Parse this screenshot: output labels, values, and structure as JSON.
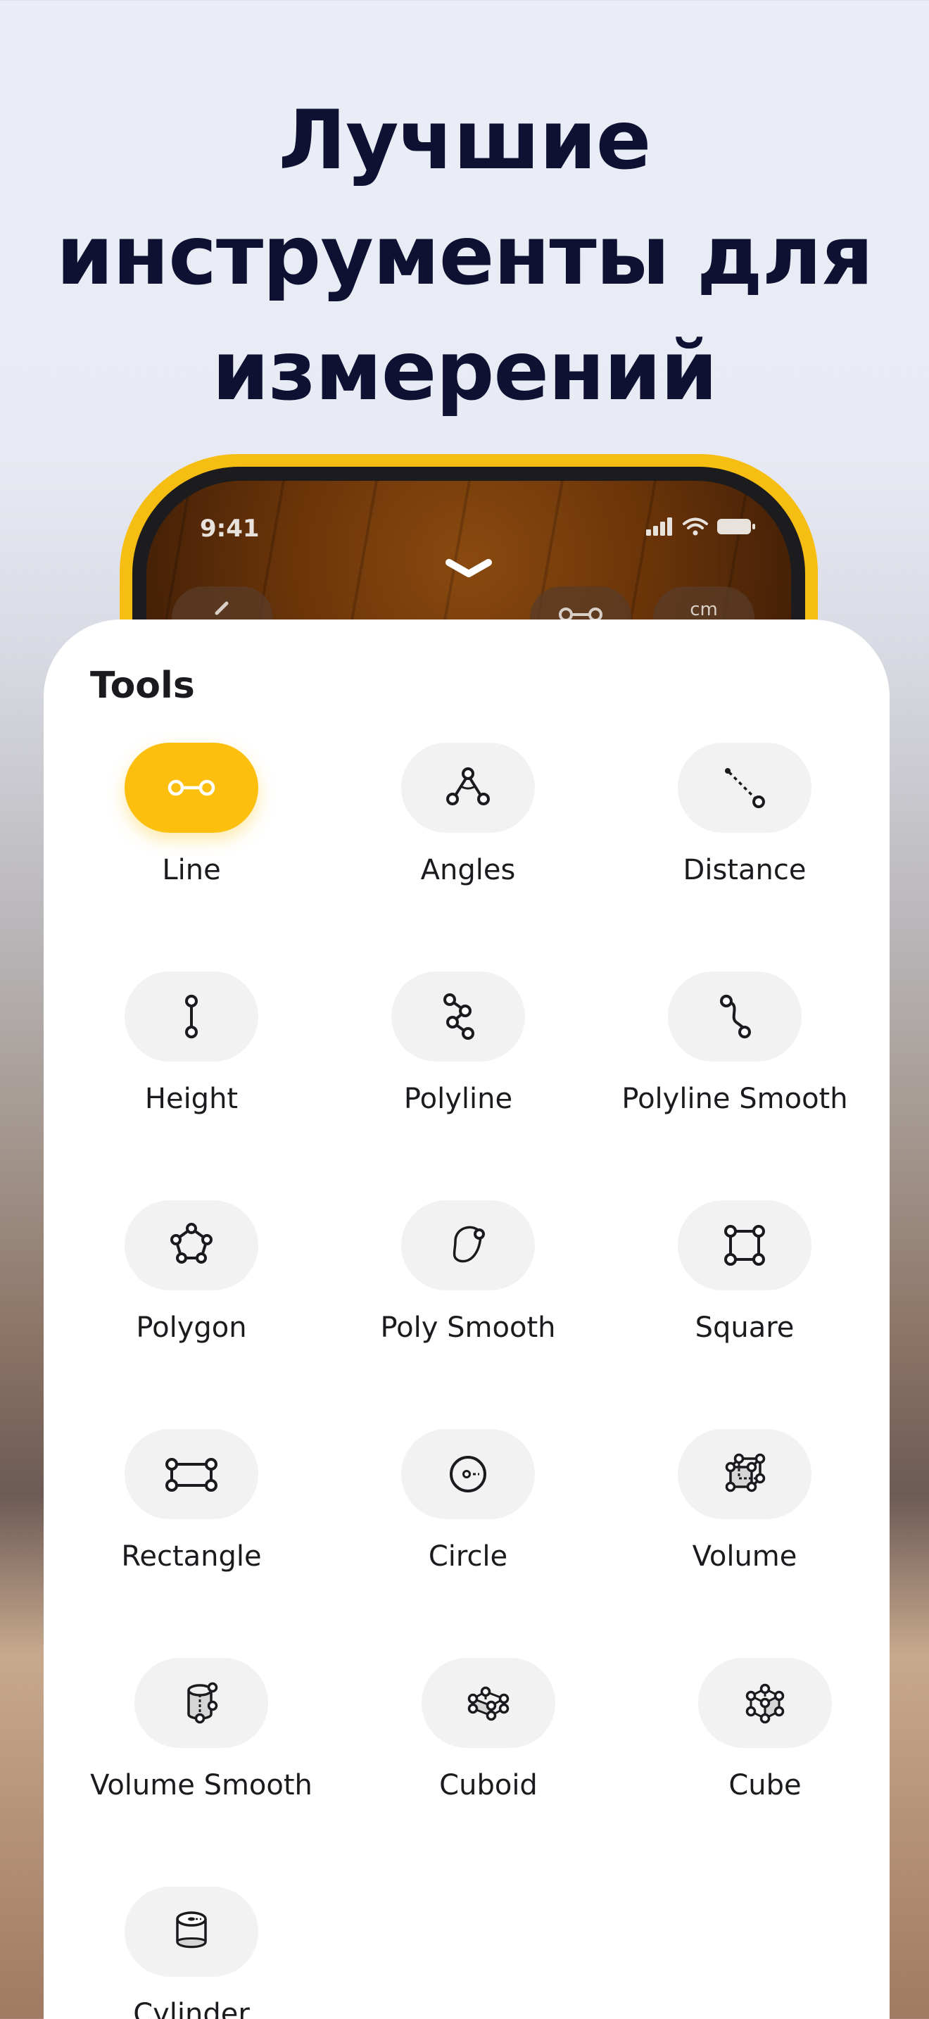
{
  "headline": {
    "line1": "Лучшие",
    "line2": "инструменты для",
    "line3": "измерений"
  },
  "phone": {
    "status_time": "9:41",
    "frame_color": "#f6bd12",
    "partial_button_unit": "cm"
  },
  "sheet": {
    "title": "Tools",
    "selected_tool": "Line",
    "accent_color": "#fcbf0d",
    "tools": [
      {
        "label": "Line",
        "icon": "line-icon"
      },
      {
        "label": "Angles",
        "icon": "angles-icon"
      },
      {
        "label": "Distance",
        "icon": "distance-icon"
      },
      {
        "label": "Height",
        "icon": "height-icon"
      },
      {
        "label": "Polyline",
        "icon": "polyline-icon"
      },
      {
        "label": "Polyline Smooth",
        "icon": "polyline-smooth-icon"
      },
      {
        "label": "Polygon",
        "icon": "polygon-icon"
      },
      {
        "label": "Poly Smooth",
        "icon": "poly-smooth-icon"
      },
      {
        "label": "Square",
        "icon": "square-icon"
      },
      {
        "label": "Rectangle",
        "icon": "rectangle-icon"
      },
      {
        "label": "Circle",
        "icon": "circle-icon"
      },
      {
        "label": "Volume",
        "icon": "volume-icon"
      },
      {
        "label": "Volume Smooth",
        "icon": "volume-smooth-icon"
      },
      {
        "label": "Cuboid",
        "icon": "cuboid-icon"
      },
      {
        "label": "Cube",
        "icon": "cube-icon"
      },
      {
        "label": "Cylinder",
        "icon": "cylinder-icon"
      }
    ]
  }
}
